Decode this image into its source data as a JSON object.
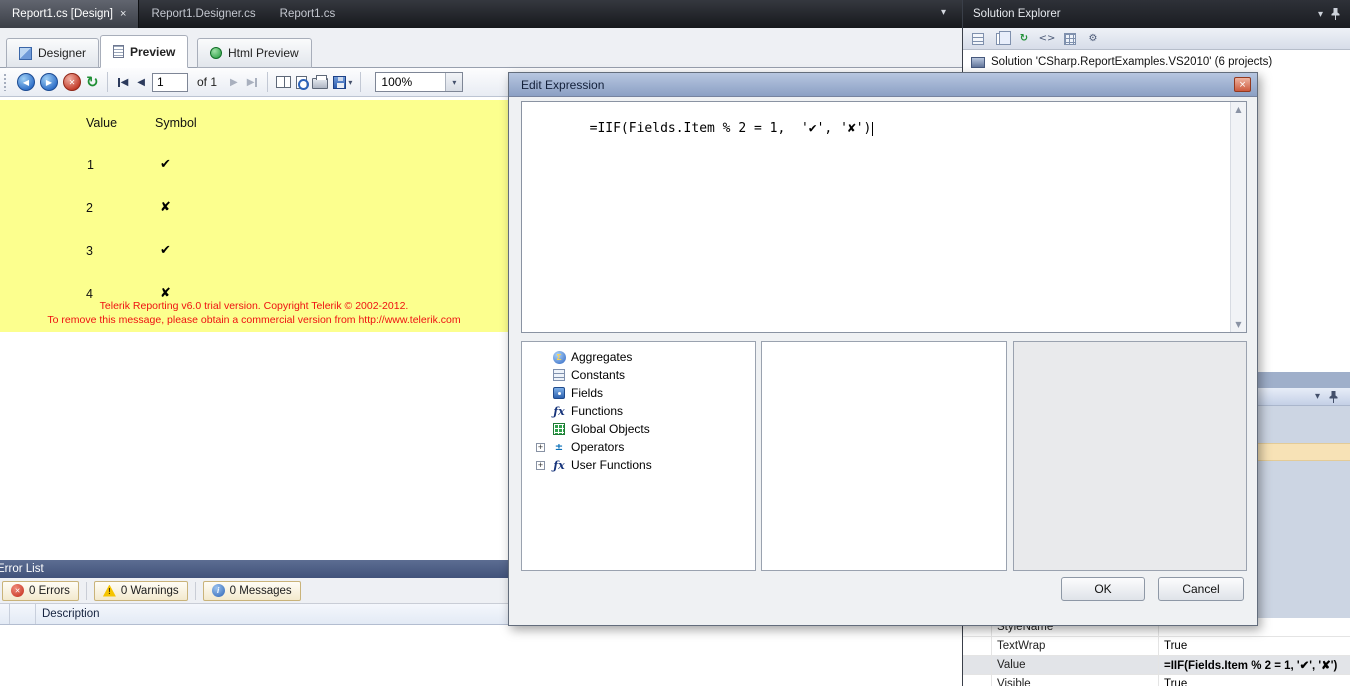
{
  "icons": {
    "close": "×",
    "dropdown": "▾",
    "back": "◀",
    "forward": "▶",
    "stop": "✕",
    "refresh": "↻",
    "prev": "◀",
    "next": "▶",
    "scroll_up": "▲",
    "scroll_down": "▼",
    "expander_plus": "+",
    "sigma": "Σ",
    "fx": "ƒx",
    "operators": "±",
    "error": "✕",
    "warning": "!",
    "info": "i",
    "code": "<>",
    "gear": "⚙"
  },
  "top_tabs": {
    "items": [
      {
        "label": "Report1.cs [Design]"
      },
      {
        "label": "Report1.Designer.cs"
      },
      {
        "label": "Report1.cs"
      }
    ]
  },
  "solution_explorer": {
    "title": "Solution Explorer",
    "root_label": "Solution 'CSharp.ReportExamples.VS2010' (6 projects)"
  },
  "editor_tabs": {
    "items": [
      {
        "label": "Designer"
      },
      {
        "label": "Preview"
      },
      {
        "label": "Html Preview"
      }
    ]
  },
  "preview_toolbar": {
    "page_value": "1",
    "page_of": "of 1",
    "zoom_value": "100%"
  },
  "report": {
    "col_value": "Value",
    "col_symbol": "Symbol",
    "rows": [
      {
        "value": "1",
        "symbol": "✔"
      },
      {
        "value": "2",
        "symbol": "✘"
      },
      {
        "value": "3",
        "symbol": "✔"
      },
      {
        "value": "4",
        "symbol": "✘"
      }
    ],
    "trial_line1": "Telerik Reporting v6.0 trial version. Copyright Telerik © 2002-2012.",
    "trial_line2": "To remove this message, please obtain a commercial version from http://www.telerik.com"
  },
  "error_list": {
    "title": "Error List",
    "errors_label": "0 Errors",
    "warnings_label": "0 Warnings",
    "messages_label": "0 Messages",
    "description_header": "Description"
  },
  "dialog": {
    "title": "Edit Expression",
    "expression": "=IIF(Fields.Item % 2 = 1,  '✔', '✘')",
    "tree_items": [
      {
        "label": "Aggregates"
      },
      {
        "label": "Constants"
      },
      {
        "label": "Fields"
      },
      {
        "label": "Functions"
      },
      {
        "label": "Global Objects"
      },
      {
        "label": "Operators"
      },
      {
        "label": "User Functions"
      }
    ],
    "ok_label": "OK",
    "cancel_label": "Cancel"
  },
  "properties_panel": {
    "rows": [
      {
        "name": "StyleName",
        "value": ""
      },
      {
        "name": "TextWrap",
        "value": "True"
      },
      {
        "name": "Value",
        "value": "=IIF(Fields.Item % 2 = 1, '✔', '✘')"
      },
      {
        "name": "Visible",
        "value": "True"
      }
    ]
  }
}
